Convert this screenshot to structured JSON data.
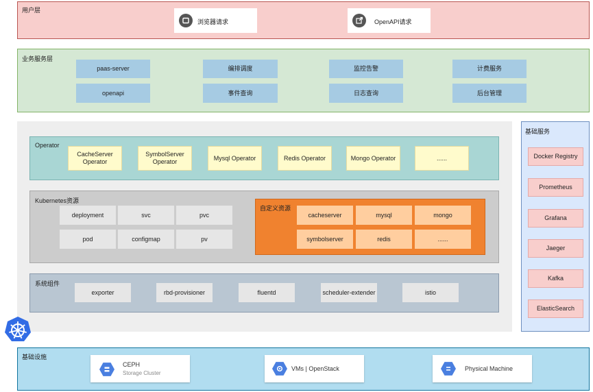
{
  "user_layer": {
    "title": "用户层",
    "browser_label": "浏览器请求",
    "openapi_label": "OpenAPI请求"
  },
  "business_layer": {
    "title": "业务服务层",
    "items": [
      "paas-server",
      "编排调度",
      "监控告警",
      "计费服务",
      "openapi",
      "事件查询",
      "日志查询",
      "后台管理"
    ]
  },
  "operator": {
    "title": "Operator",
    "items": [
      "CacheServer\nOperator",
      "SymbolServer\nOperator",
      "Mysql Operator",
      "Redis Operator",
      "Mongo Operator",
      "......"
    ]
  },
  "kubernetes": {
    "title": "Kubernetes资源",
    "items": [
      "deployment",
      "svc",
      "pvc",
      "pod",
      "configmap",
      "pv"
    ]
  },
  "custom_resources": {
    "title": "自定义资源",
    "items": [
      "cacheserver",
      "mysql",
      "mongo",
      "symbolserver",
      "redis",
      "......"
    ]
  },
  "system_components": {
    "title": "系统组件",
    "items": [
      "exporter",
      "rbd-provisioner",
      "fluentd",
      "scheduler-extender",
      "istio"
    ]
  },
  "base_services": {
    "title": "基础服务",
    "items": [
      "Docker Registry",
      "Prometheus",
      "Grafana",
      "Jaeger",
      "Kafka",
      "ElasticSearch"
    ]
  },
  "infrastructure": {
    "title": "基础设施",
    "ceph_title": "CEPH",
    "ceph_subtitle": "Storage Cluster",
    "vms_label": "VMs | OpenStack",
    "physical_label": "Physical Machine"
  },
  "colors": {
    "user_layer_bg": "#f8cecc",
    "business_layer_bg": "#d5e8d4",
    "operator_bg": "#a9d6d4",
    "kubernetes_bg": "#cccccc",
    "custom_resources_bg": "#f0822f",
    "system_components_bg": "#b9c6d2",
    "base_services_bg": "#dae8fc",
    "infrastructure_bg": "#b1ddf0"
  },
  "icons": {
    "browser": "browser-window-icon",
    "openapi": "external-link-icon",
    "kubernetes": "kubernetes-helm-icon",
    "ceph": "storage-hex-icon",
    "vms": "compute-hex-icon",
    "physical": "server-hex-icon"
  }
}
